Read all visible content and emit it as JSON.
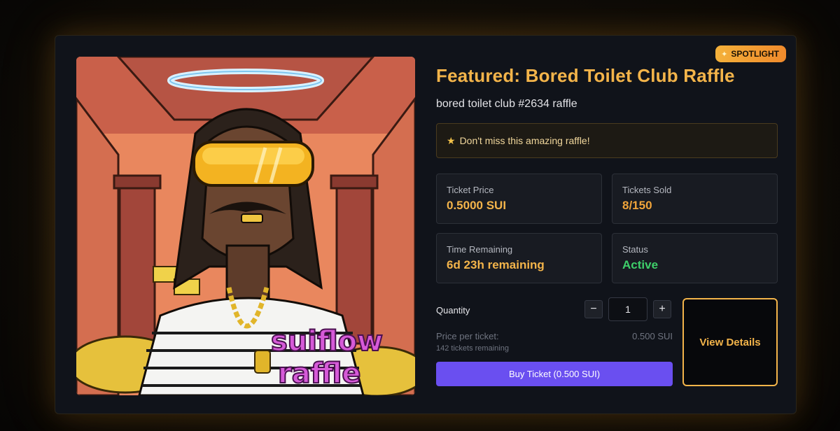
{
  "badge": {
    "label": "SPOTLIGHT",
    "icon": "sparkle-icon"
  },
  "raffle": {
    "title": "Featured: Bored Toilet Club Raffle",
    "subtitle": "bored toilet club #2634 raffle",
    "notice": "Don't miss this amazing raffle!",
    "image_watermark_line1": "suiflow",
    "image_watermark_line2": "raffle"
  },
  "stats": {
    "ticket_price": {
      "label": "Ticket Price",
      "value": "0.5000 SUI"
    },
    "tickets_sold": {
      "label": "Tickets Sold",
      "value": "8/150"
    },
    "time_remaining": {
      "label": "Time Remaining",
      "value": "6d 23h remaining"
    },
    "status": {
      "label": "Status",
      "value": "Active"
    }
  },
  "purchase": {
    "quantity_label": "Quantity",
    "quantity_value": "1",
    "minus": "−",
    "plus": "+",
    "price_per_ticket_label": "Price per ticket:",
    "price_per_ticket_value": "0.500 SUI",
    "tickets_remaining": "142 tickets remaining",
    "buy_label": "Buy Ticket (0.500 SUI)"
  },
  "actions": {
    "view_details": "View Details"
  },
  "colors": {
    "accent": "#f3b44a",
    "status_active": "#3ecf6a",
    "buy_button": "#6a4ff0",
    "watermark": "#d65ad8"
  }
}
